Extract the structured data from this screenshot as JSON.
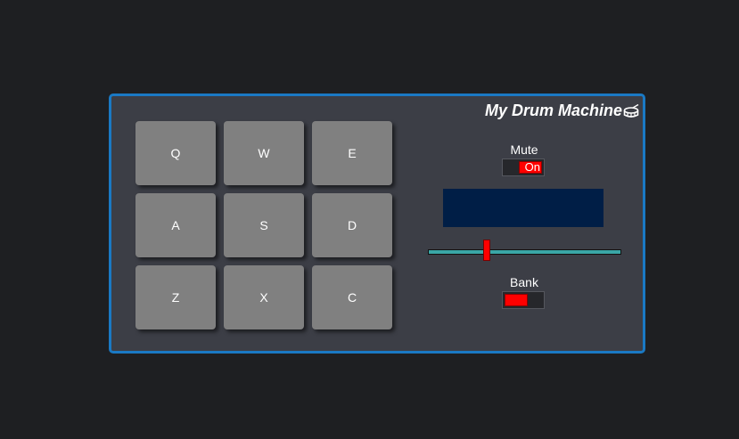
{
  "app": {
    "title": "My Drum Machine",
    "title_icon": "drum-icon"
  },
  "pads": [
    {
      "key": "Q"
    },
    {
      "key": "W"
    },
    {
      "key": "E"
    },
    {
      "key": "A"
    },
    {
      "key": "S"
    },
    {
      "key": "D"
    },
    {
      "key": "Z"
    },
    {
      "key": "X"
    },
    {
      "key": "C"
    }
  ],
  "controls": {
    "mute": {
      "label": "Mute",
      "state_text": "On"
    },
    "display": {
      "text": ""
    },
    "volume": {
      "value": 0.3
    },
    "bank": {
      "label": "Bank"
    }
  },
  "colors": {
    "accent": "#1a79c4",
    "toggle_knob": "#ff0000",
    "display_bg": "#001e46",
    "slider_track": "#3aa6a6",
    "pad_bg": "#808080",
    "panel_bg": "#3c3e46"
  }
}
